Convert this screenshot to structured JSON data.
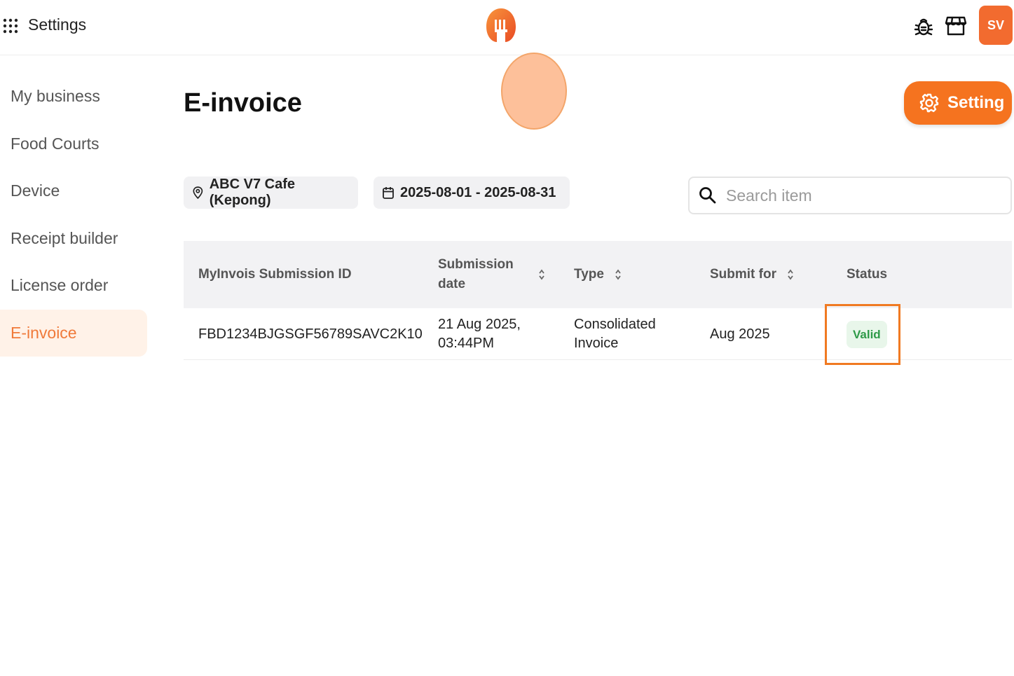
{
  "header": {
    "title": "Settings",
    "avatar_initials": "SV",
    "brand_color": "#f5731f"
  },
  "sidebar": {
    "items": [
      {
        "label": "My business"
      },
      {
        "label": "Food Courts"
      },
      {
        "label": "Device"
      },
      {
        "label": "Receipt builder"
      },
      {
        "label": "License order"
      },
      {
        "label": "E-invoice",
        "active": true
      }
    ]
  },
  "main": {
    "title": "E-invoice",
    "setting_button": "Setting",
    "filters": {
      "location": "ABC V7 Cafe (Kepong)",
      "date_range": "2025-08-01 - 2025-08-31"
    },
    "search": {
      "placeholder": "Search item",
      "value": ""
    },
    "table": {
      "columns": [
        {
          "label": "MyInvois Submission ID",
          "sortable": false
        },
        {
          "label": "Submission date",
          "sortable": true
        },
        {
          "label": "Type",
          "sortable": true
        },
        {
          "label": "Submit for",
          "sortable": true
        },
        {
          "label": "Status",
          "sortable": false
        }
      ],
      "rows": [
        {
          "id": "FBD1234BJGSGF56789SAVC2K10",
          "date_line1": "21 Aug 2025,",
          "date_line2": "03:44PM",
          "type_line1": "Consolidated",
          "type_line2": "Invoice",
          "submit_for": "Aug 2025",
          "status": "Valid",
          "status_color": "#2e9a48"
        }
      ]
    }
  },
  "icons": [
    "apps-grid-icon",
    "fork-logo-icon",
    "bug-icon",
    "store-icon",
    "gear-icon",
    "location-pin-icon",
    "calendar-icon",
    "search-icon",
    "sort-icon"
  ]
}
